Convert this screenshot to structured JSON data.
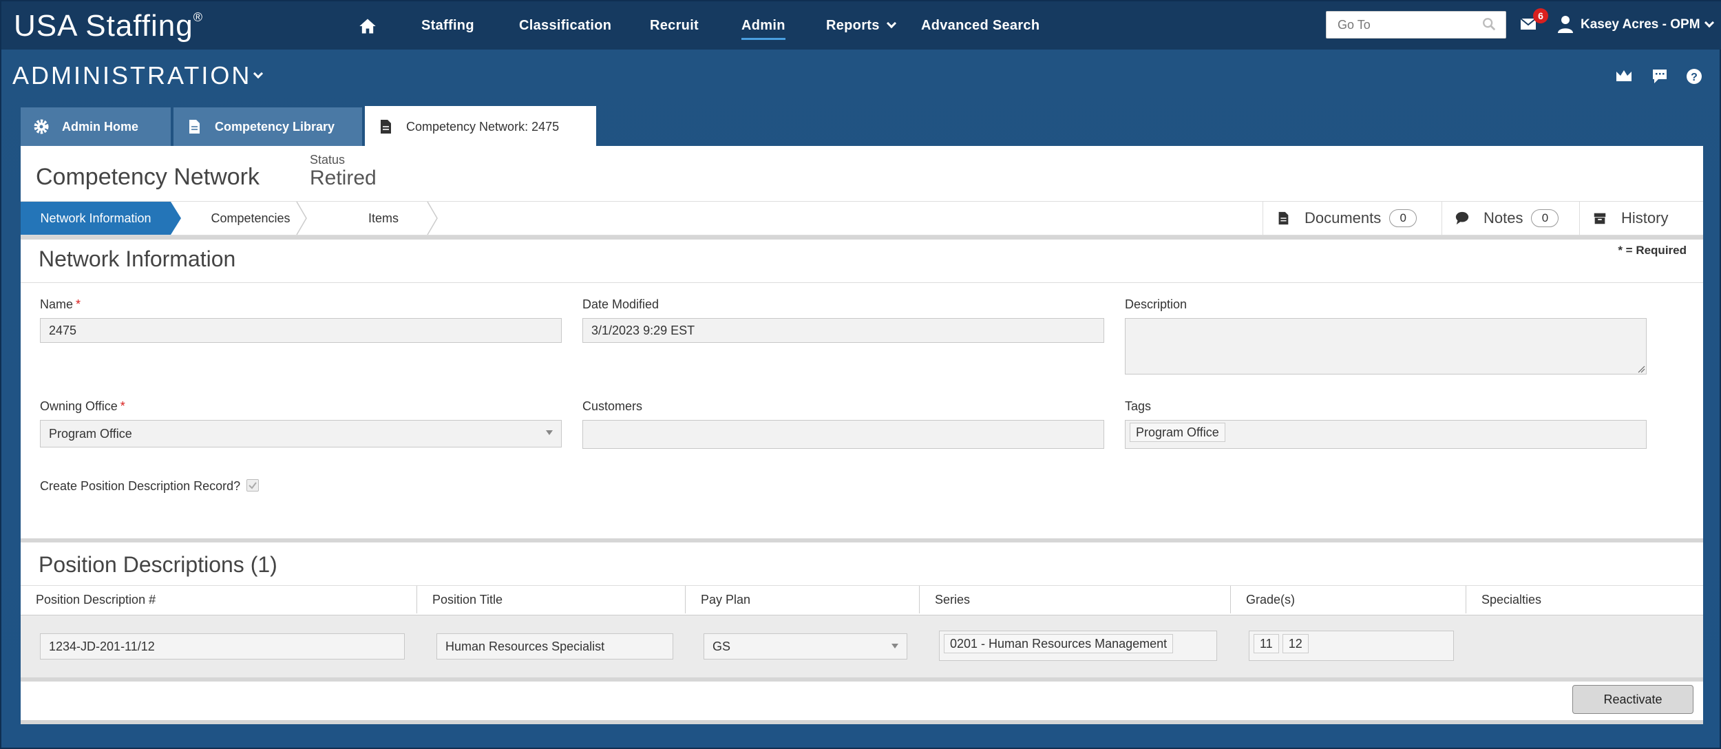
{
  "brand": {
    "name": "USA Staffing",
    "mark": "®"
  },
  "nav": {
    "items": [
      {
        "label": "Staffing"
      },
      {
        "label": "Classification"
      },
      {
        "label": "Recruit"
      },
      {
        "label": "Admin",
        "active": true
      },
      {
        "label": "Reports"
      },
      {
        "label": "Advanced Search"
      }
    ],
    "goto_placeholder": "Go To",
    "mail_count": "6",
    "user": "Kasey Acres - OPM"
  },
  "section": {
    "title": "ADMINISTRATION"
  },
  "tabs": [
    {
      "label": "Admin Home",
      "icon": "gear-icon"
    },
    {
      "label": "Competency Library",
      "icon": "document-icon"
    },
    {
      "label": "Competency Network: 2475",
      "icon": "document-icon",
      "active": true
    }
  ],
  "page": {
    "title": "Competency Network",
    "status_label": "Status",
    "status_value": "Retired"
  },
  "steps": [
    {
      "label": "Network Information",
      "active": true
    },
    {
      "label": "Competencies"
    },
    {
      "label": "Items"
    }
  ],
  "side_buttons": {
    "documents": {
      "label": "Documents",
      "count": "0"
    },
    "notes": {
      "label": "Notes",
      "count": "0"
    },
    "history": {
      "label": "History"
    }
  },
  "network_info": {
    "title": "Network Information",
    "required_note": "* = Required",
    "name_label": "Name",
    "name_value": "2475",
    "date_modified_label": "Date Modified",
    "date_modified_value": "3/1/2023 9:29 EST",
    "description_label": "Description",
    "description_value": "",
    "owning_office_label": "Owning Office",
    "owning_office_value": "Program Office",
    "customers_label": "Customers",
    "customers_value": "",
    "tags_label": "Tags",
    "tags": [
      "Program Office"
    ],
    "create_pd_label": "Create Position Description Record?",
    "create_pd_checked": true
  },
  "position_descriptions": {
    "title": "Position Descriptions (1)",
    "columns": [
      "Position Description #",
      "Position Title",
      "Pay Plan",
      "Series",
      "Grade(s)",
      "Specialties"
    ],
    "rows": [
      {
        "pd_number": "1234-JD-201-11/12",
        "position_title": "Human Resources Specialist",
        "pay_plan": "GS",
        "series": "0201 - Human Resources Management",
        "grades": [
          "11",
          "12"
        ],
        "specialties": ""
      }
    ]
  },
  "actions": {
    "reactivate": "Reactivate"
  }
}
